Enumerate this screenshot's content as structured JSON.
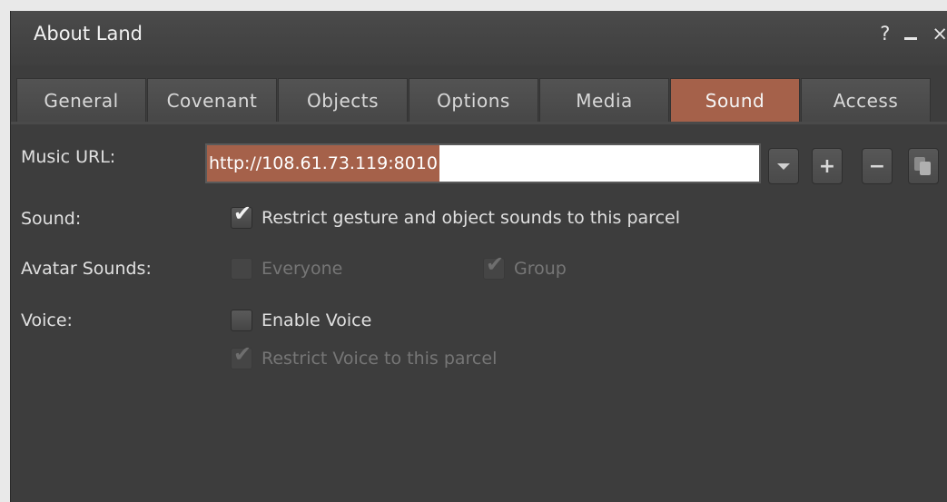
{
  "window": {
    "title": "About Land",
    "controls": {
      "help": "?",
      "close": "×"
    }
  },
  "tabs": [
    {
      "label": "General",
      "active": false
    },
    {
      "label": "Covenant",
      "active": false
    },
    {
      "label": "Objects",
      "active": false
    },
    {
      "label": "Options",
      "active": false
    },
    {
      "label": "Media",
      "active": false
    },
    {
      "label": "Sound",
      "active": true
    },
    {
      "label": "Access",
      "active": false
    }
  ],
  "music": {
    "label": "Music URL:",
    "value": "http://108.61.73.119:8010",
    "buttons": {
      "add": "+",
      "remove": "−"
    }
  },
  "sound": {
    "label": "Sound:",
    "restrict_label": "Restrict gesture and object sounds to this parcel",
    "restrict_checked": true
  },
  "avatar_sounds": {
    "label": "Avatar Sounds:",
    "everyone_label": "Everyone",
    "everyone_checked": false,
    "group_label": "Group",
    "group_checked": true
  },
  "voice": {
    "label": "Voice:",
    "enable_label": "Enable Voice",
    "enable_checked": false,
    "restrict_label": "Restrict Voice to this parcel",
    "restrict_checked": true
  },
  "colors": {
    "accent": "#a5614a",
    "panel": "#3d3d3d",
    "text": "#e0e0e0",
    "disabled_text": "#767676"
  }
}
